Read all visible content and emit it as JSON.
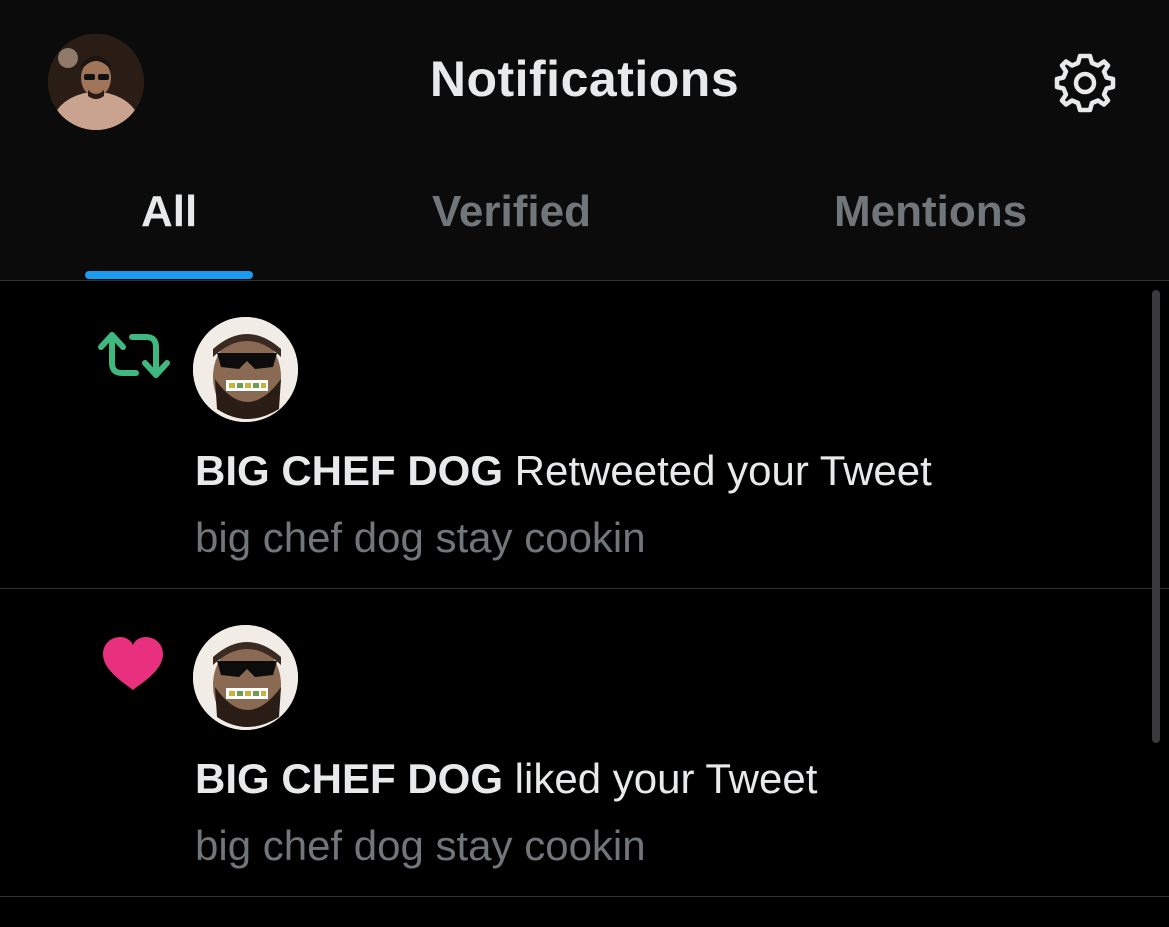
{
  "header": {
    "title": "Notifications",
    "avatar_icon": "profile-avatar",
    "settings_icon": "gear-icon"
  },
  "tabs": [
    {
      "label": "All",
      "active": true
    },
    {
      "label": "Verified",
      "active": false
    },
    {
      "label": "Mentions",
      "active": false
    }
  ],
  "colors": {
    "accent": "#1d9bf0",
    "retweet": "#3fb87f",
    "like": "#e9307f",
    "secondary_text": "#71767b"
  },
  "notifications": [
    {
      "type": "retweet",
      "icon": "retweet-icon",
      "user_name": "BIG CHEF DOG",
      "action_text": " Retweeted your Tweet",
      "tweet_text": "big chef dog stay cookin"
    },
    {
      "type": "like",
      "icon": "heart-icon",
      "user_name": "BIG CHEF DOG",
      "action_text": " liked your Tweet",
      "tweet_text": "big chef dog stay cookin"
    }
  ]
}
